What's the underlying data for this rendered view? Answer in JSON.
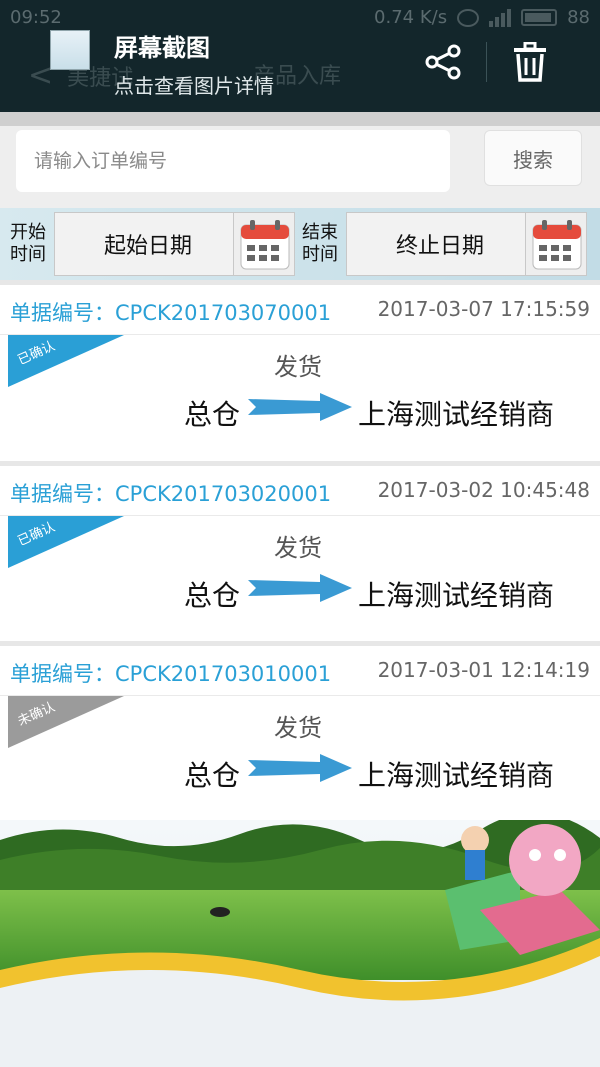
{
  "status_bar": {
    "time": "09:52",
    "speed": "0.74 K/s",
    "battery": "88"
  },
  "app_header": {
    "back_symbol": "<",
    "title_left": "美捷试",
    "title_right": "产品入库"
  },
  "overlay": {
    "title": "屏幕截图",
    "subtitle": "点击查看图片详情"
  },
  "search": {
    "placeholder": "请输入订单编号",
    "button_label": "搜索"
  },
  "date_filter": {
    "start_label_line1": "开始",
    "start_label_line2": "时间",
    "start_value": "起始日期",
    "end_label_line1": "结束",
    "end_label_line2": "时间",
    "end_value": "终止日期"
  },
  "orders": [
    {
      "number": "单据编号：CPCK201703070001",
      "time": "2017-03-07 17:15:59",
      "status": "已确认",
      "status_color": "#2a9fd6",
      "action": "发货",
      "from": "总仓",
      "to": "上海测试经销商"
    },
    {
      "number": "单据编号：CPCK201703020001",
      "time": "2017-03-02 10:45:48",
      "status": "已确认",
      "status_color": "#2a9fd6",
      "action": "发货",
      "from": "总仓",
      "to": "上海测试经销商"
    },
    {
      "number": "单据编号：CPCK201703010001",
      "time": "2017-03-01 12:14:19",
      "status": "未确认",
      "status_color": "#9b9b9b",
      "action": "发货",
      "from": "总仓",
      "to": "上海测试经销商"
    }
  ],
  "colors": {
    "accent": "#2aa0d6",
    "arrow": "#3a9ad3",
    "header_bg": "#13262b"
  },
  "icons": {
    "share": "share-icon",
    "trash": "trash-icon",
    "calendar": "calendar-icon",
    "back": "chevron-left-icon"
  }
}
